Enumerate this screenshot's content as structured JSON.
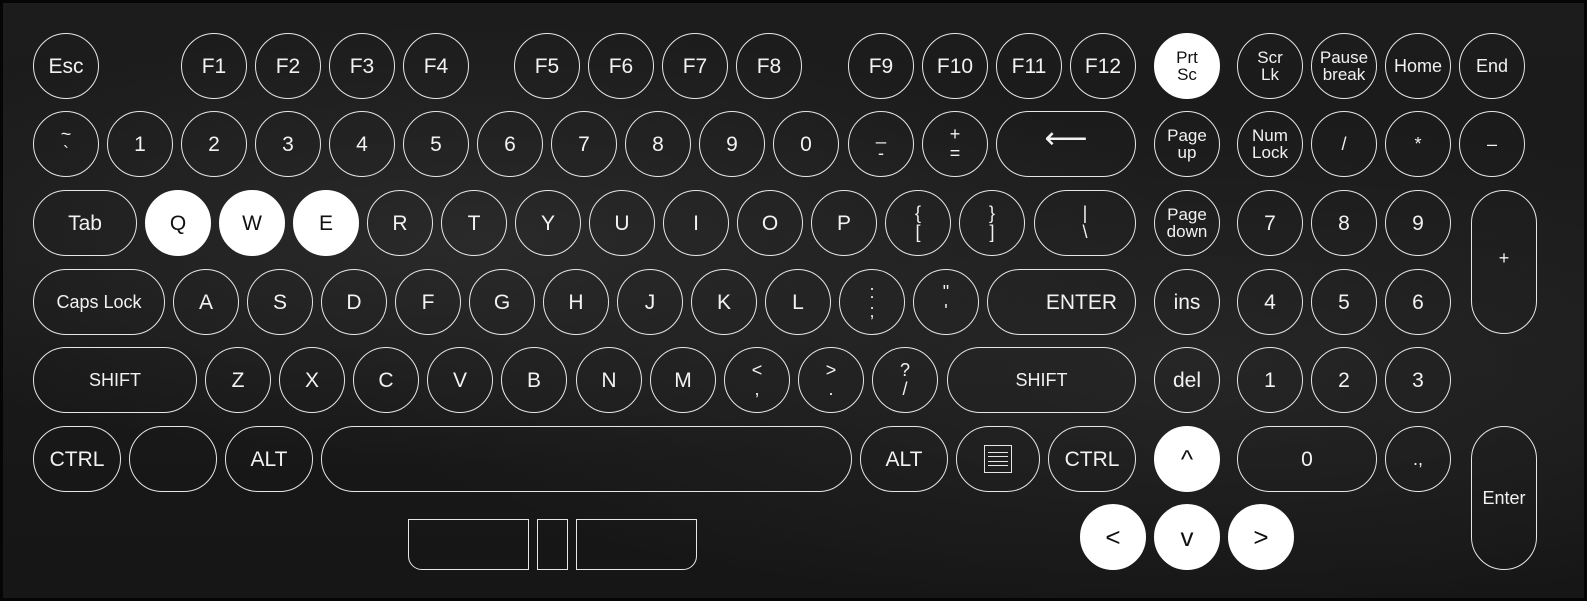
{
  "keyboard": {
    "accent_color": "#ffffff",
    "key_border_color": "#e6e6e6",
    "row_function": [
      "Esc",
      "F1",
      "F2",
      "F3",
      "F4",
      "F5",
      "F6",
      "F7",
      "F8",
      "F9",
      "F10",
      "F11",
      "F12"
    ],
    "prtsc": [
      "Prt",
      "Sc"
    ],
    "scrlk": [
      "Scr",
      "Lk"
    ],
    "pause": [
      "Pause",
      "break"
    ],
    "home": "Home",
    "end": "End",
    "row_number": {
      "tilde": [
        "~",
        "`"
      ],
      "digits": [
        "1",
        "2",
        "3",
        "4",
        "5",
        "6",
        "7",
        "8",
        "9",
        "0"
      ],
      "minus": [
        "_",
        "-"
      ],
      "plus": [
        "+",
        "="
      ],
      "backspace": "⟵"
    },
    "pageup": [
      "Page",
      "up"
    ],
    "numlock": [
      "Num",
      "Lock"
    ],
    "np_slash": "/",
    "np_star": "*",
    "np_minus": "–",
    "row_q": {
      "tab": "Tab",
      "letters": [
        "Q",
        "W",
        "E",
        "R",
        "T",
        "Y",
        "U",
        "I",
        "O",
        "P"
      ],
      "lbrace": [
        "{",
        "["
      ],
      "rbrace": [
        "}",
        "]"
      ],
      "pipe": [
        "|",
        "\\"
      ]
    },
    "pagedown": [
      "Page",
      "down"
    ],
    "np_row1": [
      "7",
      "8",
      "9"
    ],
    "np_plus": "+",
    "row_a": {
      "caps": "Caps Lock",
      "letters": [
        "A",
        "S",
        "D",
        "F",
        "G",
        "H",
        "J",
        "K",
        "L"
      ],
      "colon": [
        ":",
        ";"
      ],
      "quote": [
        "\"",
        "'"
      ],
      "enter": "ENTER"
    },
    "ins": "ins",
    "np_row2": [
      "4",
      "5",
      "6"
    ],
    "row_z": {
      "shift": "SHIFT",
      "letters": [
        "Z",
        "X",
        "C",
        "V",
        "B",
        "N",
        "M"
      ],
      "lt": [
        "<",
        ","
      ],
      "gt": [
        ">",
        "."
      ],
      "question": [
        "?",
        "/"
      ],
      "shift_right": "SHIFT"
    },
    "del": "del",
    "np_row3": [
      "1",
      "2",
      "3"
    ],
    "row_bottom": {
      "ctrl": "CTRL",
      "win": "",
      "alt": "ALT",
      "alt_right": "ALT",
      "ctrl_right": "CTRL"
    },
    "arrow_up": "^",
    "np_zero": "0",
    "np_dot": ".,",
    "np_enter": "Enter",
    "arrow_left": "<",
    "arrow_down": "v",
    "arrow_right": ">",
    "active_keys": [
      "Q",
      "W",
      "E",
      "Prt Sc",
      "^",
      "<",
      "v",
      ">"
    ]
  }
}
